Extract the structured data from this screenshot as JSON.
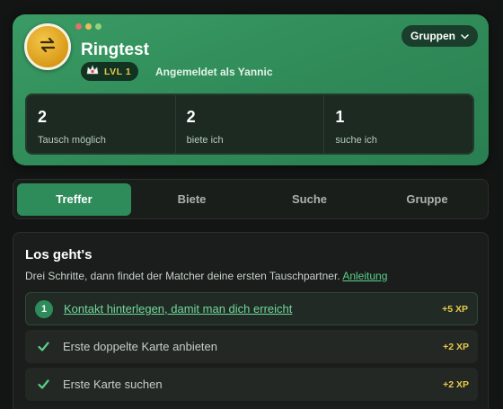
{
  "colors": {
    "accent_green": "#2e8b5a",
    "hero_green": "#3a9b64",
    "xp_gold": "#e8c94a",
    "link_green": "#5ccf8b",
    "traffic_red": "#e0726a",
    "traffic_yellow": "#e2c15a",
    "traffic_green": "#8fd27e"
  },
  "header": {
    "title": "Ringtest",
    "logo_icon": "swap-arrows-icon",
    "level_badge": {
      "icon": "crown-icon",
      "label": "LVL 1"
    },
    "signed_in_text": "Angemeldet als Yannic",
    "groups_button": {
      "label": "Gruppen",
      "icon": "chevron-down-icon"
    },
    "stats": [
      {
        "value": "2",
        "label": "Tausch möglich"
      },
      {
        "value": "2",
        "label": "biete ich"
      },
      {
        "value": "1",
        "label": "suche ich"
      }
    ]
  },
  "tabs": [
    {
      "label": "Treffer",
      "active": true
    },
    {
      "label": "Biete",
      "active": false
    },
    {
      "label": "Suche",
      "active": false
    },
    {
      "label": "Gruppe",
      "active": false
    }
  ],
  "onboarding": {
    "title": "Los geht's",
    "subtitle": "Drei Schritte, dann findet der Matcher deine ersten Tauschpartner.",
    "guide_link": "Anleitung",
    "steps": [
      {
        "marker": "1",
        "label": "Kontakt hinterlegen, damit man dich erreicht",
        "xp": "+5 XP",
        "done": false
      },
      {
        "marker": "check-icon",
        "label": "Erste doppelte Karte anbieten",
        "xp": "+2 XP",
        "done": true
      },
      {
        "marker": "check-icon",
        "label": "Erste Karte suchen",
        "xp": "+2 XP",
        "done": true
      }
    ]
  }
}
